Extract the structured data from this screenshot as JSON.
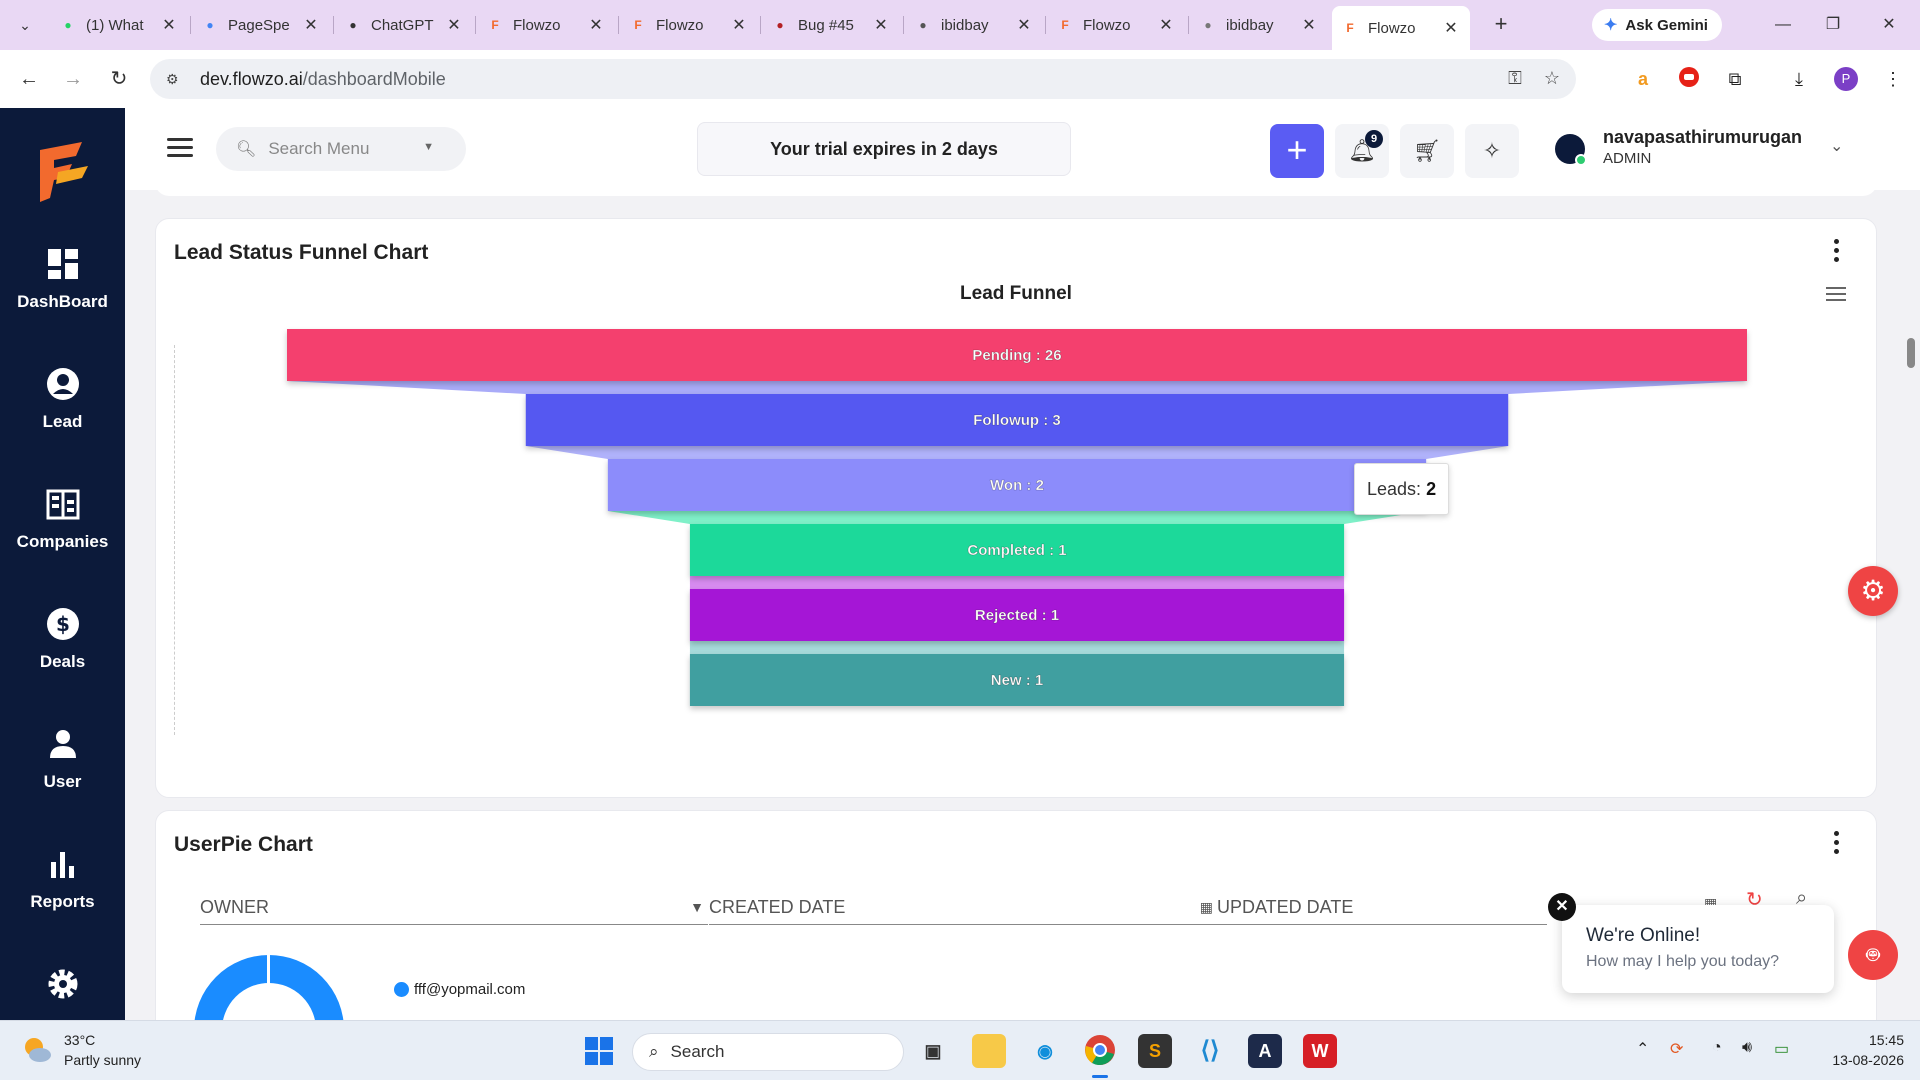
{
  "browser": {
    "tabs": [
      {
        "title": "(1) What",
        "favicon": "whatsapp-icon",
        "color": "#25d366"
      },
      {
        "title": "PageSpe",
        "favicon": "pagespeed-icon",
        "color": "#4285f4"
      },
      {
        "title": "ChatGPT",
        "favicon": "chatgpt-icon",
        "color": "#333333"
      },
      {
        "title": "Flowzo",
        "favicon": "flowzo-icon",
        "color": "#f26a2e"
      },
      {
        "title": "Flowzo",
        "favicon": "flowzo-icon",
        "color": "#f26a2e"
      },
      {
        "title": "Bug #45",
        "favicon": "redmine-icon",
        "color": "#b32024"
      },
      {
        "title": "ibidbay",
        "favicon": "globe-icon",
        "color": "#555555"
      },
      {
        "title": "Flowzo",
        "favicon": "flowzo-icon",
        "color": "#f26a2e"
      },
      {
        "title": "ibidbay",
        "favicon": "ibidbay-icon",
        "color": "#777777"
      },
      {
        "title": "Flowzo",
        "favicon": "flowzo-icon",
        "color": "#f26a2e",
        "active": true
      }
    ],
    "gemini_label": "Ask Gemini",
    "url_host": "dev.flowzo.ai",
    "url_path": "/dashboardMobile",
    "profile_initial": "P"
  },
  "sidebar": {
    "items": [
      {
        "label": "DashBoard",
        "icon": "dashboard-icon"
      },
      {
        "label": "Lead",
        "icon": "lead-icon"
      },
      {
        "label": "Companies",
        "icon": "companies-icon"
      },
      {
        "label": "Deals",
        "icon": "deals-icon"
      },
      {
        "label": "User",
        "icon": "user-icon"
      },
      {
        "label": "Reports",
        "icon": "reports-icon"
      }
    ]
  },
  "header": {
    "search_placeholder": "Search Menu",
    "trial_text": "Your trial expires in 2 days",
    "notification_count": "9",
    "user_name": "navapasathirumurugan",
    "user_role": "ADMIN"
  },
  "funnel_card": {
    "title": "Lead Status Funnel Chart",
    "tooltip_label": "Leads:",
    "tooltip_value": "2"
  },
  "chart_data": {
    "type": "funnel",
    "title": "Lead Funnel",
    "categories": [
      "Pending",
      "Followup",
      "Won",
      "Completed",
      "Rejected",
      "New"
    ],
    "values": [
      26,
      3,
      2,
      1,
      1,
      1
    ],
    "colors": [
      "#f43f6e",
      "#5558f1",
      "#8c8cfb",
      "#1ed99a",
      "#a514d6",
      "#3f9fa0"
    ],
    "connector_colors": [
      "#a9abf8",
      "#b0b2fb",
      "#7ff0c8",
      "#d78bf0",
      "#a6dada"
    ]
  },
  "userpie_card": {
    "title": "UserPie Chart",
    "filters": {
      "owner": "OWNER",
      "created": "CREATED DATE",
      "updated": "UPDATED DATE"
    },
    "legend": [
      "fff@yopmail.com"
    ]
  },
  "chat_widget": {
    "title": "We're Online!",
    "subtitle": "How may I help you today?"
  },
  "taskbar": {
    "temperature": "33°C",
    "weather": "Partly sunny",
    "search_label": "Search",
    "time": "15:45",
    "date": "13-08-2026"
  }
}
